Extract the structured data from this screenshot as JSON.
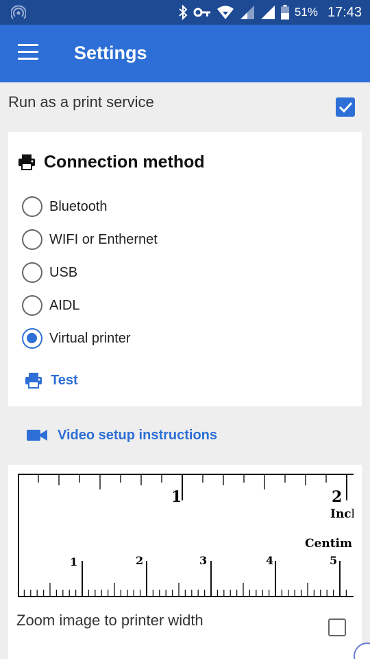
{
  "status_bar": {
    "battery_percent": "51%",
    "time": "17:43"
  },
  "app_bar": {
    "title": "Settings"
  },
  "run_as_service": {
    "label": "Run as a print service",
    "checked": true
  },
  "connection": {
    "title": "Connection method",
    "options": [
      {
        "label": "Bluetooth",
        "selected": false
      },
      {
        "label": "WIFI or Enthernet",
        "selected": false
      },
      {
        "label": "USB",
        "selected": false
      },
      {
        "label": "AIDL",
        "selected": false
      },
      {
        "label": "Virtual printer",
        "selected": true
      }
    ],
    "test_label": "Test"
  },
  "video": {
    "label": "Video setup instructions"
  },
  "ruler": {
    "inch_numbers": [
      "1",
      "2"
    ],
    "inch_label": "Inch",
    "cm_label": "Centim",
    "cm_numbers": [
      "1",
      "2",
      "3",
      "4",
      "5"
    ]
  },
  "zoom": {
    "label": "Zoom image to printer width",
    "checked": false
  },
  "colors": {
    "status_bar": "#1e4a94",
    "app_bar": "#2d6fd6",
    "accent": "#2d6fd6",
    "background": "#eeeeee"
  }
}
